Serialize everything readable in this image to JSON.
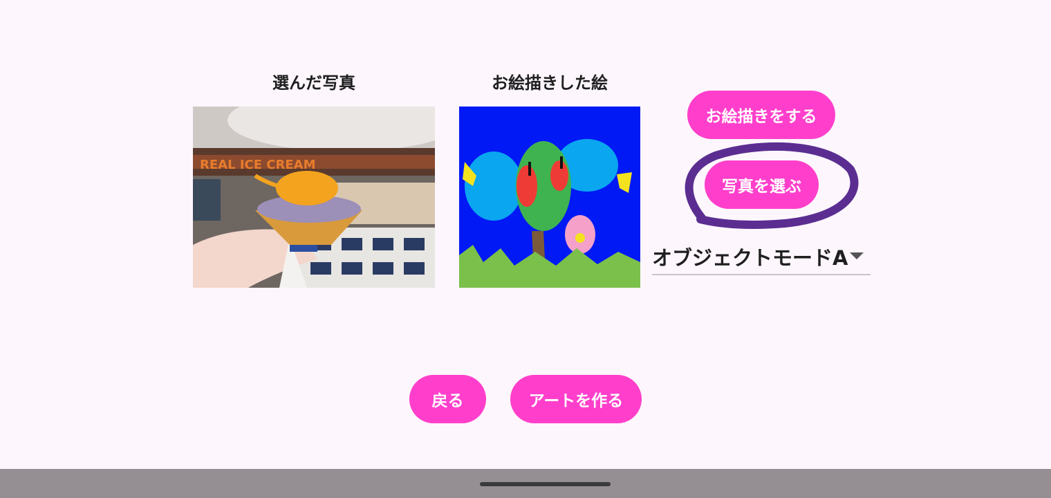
{
  "labels": {
    "selected_photo": "選んだ写真",
    "drawn_picture": "お絵描きした絵"
  },
  "buttons": {
    "draw": "お絵描きをする",
    "choose_photo": "写真を選ぶ",
    "back": "戻る",
    "make_art": "アートを作る"
  },
  "mode_select": {
    "selected": "オブジェクトモードA"
  },
  "photo_sign_text": "REAL ICE CREAM",
  "colors": {
    "accent": "#ff3fcb",
    "background": "#fdf6fd",
    "annotation": "#5b2d91",
    "navbar": "#958f94"
  },
  "icons": {
    "dropdown": "caret-down-icon"
  }
}
